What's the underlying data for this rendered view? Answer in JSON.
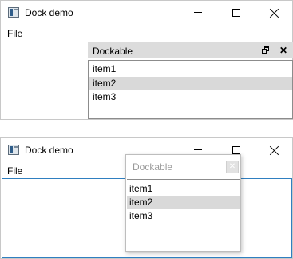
{
  "window1": {
    "title": "Dock demo",
    "menu": [
      "File"
    ],
    "dock": {
      "title": "Dockable",
      "float_button": "float-icon",
      "close_button": "✕",
      "items": [
        "item1",
        "item2",
        "item3"
      ],
      "selected_index": 1
    }
  },
  "window2": {
    "title": "Dock demo",
    "menu": [
      "File"
    ],
    "floating_dock": {
      "title": "Dockable",
      "close_button": "✕",
      "items": [
        "item1",
        "item2",
        "item3"
      ],
      "selected_index": 1
    }
  },
  "colors": {
    "selection": "#d9d9d9",
    "dock_header": "#dcdcdc",
    "focus_border": "#2f7fc0"
  }
}
